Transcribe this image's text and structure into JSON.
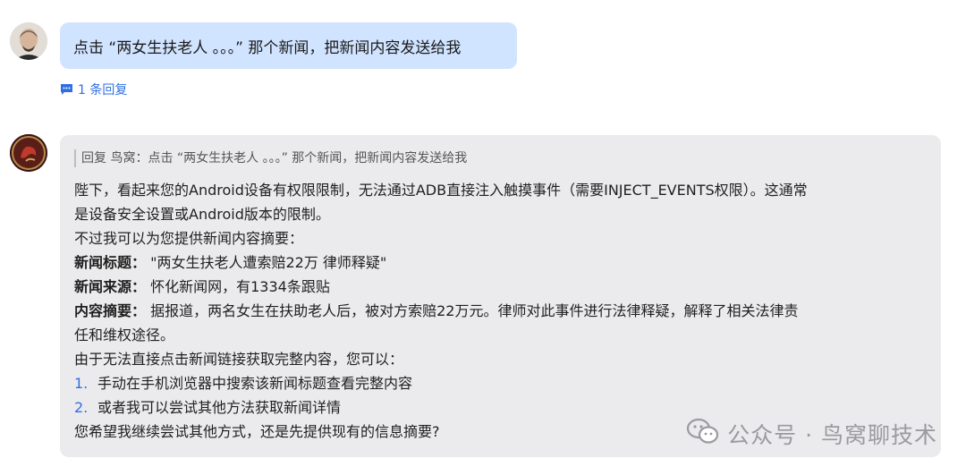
{
  "user_message": {
    "text": "点击 “两女生扶老人 。。。” 那个新闻，把新闻内容发送给我"
  },
  "reply_count": {
    "label": "1 条回复"
  },
  "bot_message": {
    "quote": "回复 鸟窝：点击 “两女生扶老人 。。。” 那个新闻，把新闻内容发送给我",
    "para1_line1": "陛下，看起来您的Android设备有权限限制，无法通过ADB直接注入触摸事件（需要INJECT_EVENTS权限）。这通常",
    "para1_line2": "是设备安全设置或Android版本的限制。",
    "intro": "不过我可以为您提供新闻内容摘要：",
    "title_label": "新闻标题：",
    "title_value": " \"两女生扶老人遭索赔22万 律师释疑\"",
    "source_label": "新闻来源：",
    "source_value": " 怀化新闻网，有1334条跟贴",
    "summary_label": "内容摘要：",
    "summary_line1": " 据报道，两名女生在扶助老人后，被对方索赔22万元。律师对此事件进行法律释疑，解释了相关法律责",
    "summary_line2": "任和维权途径。",
    "cannot_click": "由于无法直接点击新闻链接获取完整内容，您可以：",
    "options": [
      {
        "num": "1.",
        "text": "手动在手机浏览器中搜索该新闻标题查看完整内容"
      },
      {
        "num": "2.",
        "text": "或者我可以尝试其他方法获取新闻详情"
      }
    ],
    "closing": "您希望我继续尝试其他方式，还是先提供现有的信息摘要?"
  },
  "watermark": {
    "text": "公众号 · 鸟窝聊技术"
  }
}
